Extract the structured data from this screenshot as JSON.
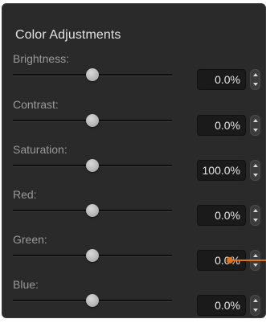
{
  "panel": {
    "title": "Color Adjustments"
  },
  "controls": [
    {
      "label": "Brightness:",
      "value": "0.0%",
      "level": 0.5
    },
    {
      "label": "Contrast:",
      "value": "0.0%",
      "level": 0.5
    },
    {
      "label": "Saturation:",
      "value": "100.0%",
      "level": 0.5
    },
    {
      "label": "Red:",
      "value": "0.0%",
      "level": 0.5
    },
    {
      "label": "Green:",
      "value": "0.0%",
      "level": 0.5
    },
    {
      "label": "Blue:",
      "value": "0.0%",
      "level": 0.5
    }
  ],
  "colors": {
    "panel_background": "#2a2a2a",
    "callout_accent": "#e0731d"
  },
  "icons": {
    "stepper_up": "chevron-up-icon",
    "stepper_down": "chevron-down-icon"
  }
}
